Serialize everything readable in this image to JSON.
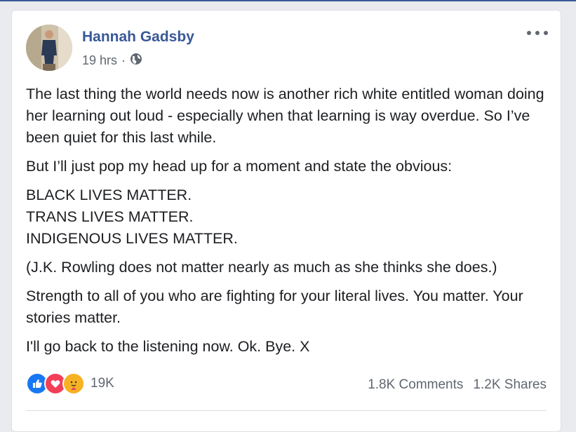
{
  "post": {
    "author": "Hannah Gadsby",
    "time": "19 hrs",
    "separator": "·",
    "privacy_icon": "globe-icon",
    "paragraphs": [
      "The last thing the world needs now is another rich white entitled woman doing her learning out loud - especially when that learning is way overdue. So I’ve been quiet for this last while.",
      "But I’ll just pop my head up for a moment and state the obvious:",
      "BLACK LIVES MATTER.",
      "TRANS LIVES MATTER.",
      "INDIGENOUS LIVES MATTER.",
      "(J.K. Rowling does not matter nearly as much as she thinks she does.)",
      "Strength to all of you who are fighting for your literal lives. You matter. Your stories matter.",
      "I'll go back to the listening now. Ok. Bye. X"
    ]
  },
  "reactions": {
    "icons": [
      "like-icon",
      "love-icon",
      "care-icon"
    ],
    "count": "19K"
  },
  "engagement": {
    "comments": "1.8K Comments",
    "shares": "1.2K Shares"
  },
  "colors": {
    "author": "#385898",
    "like": "#1877f2",
    "love": "#f33e58",
    "care": "#f7b125"
  }
}
